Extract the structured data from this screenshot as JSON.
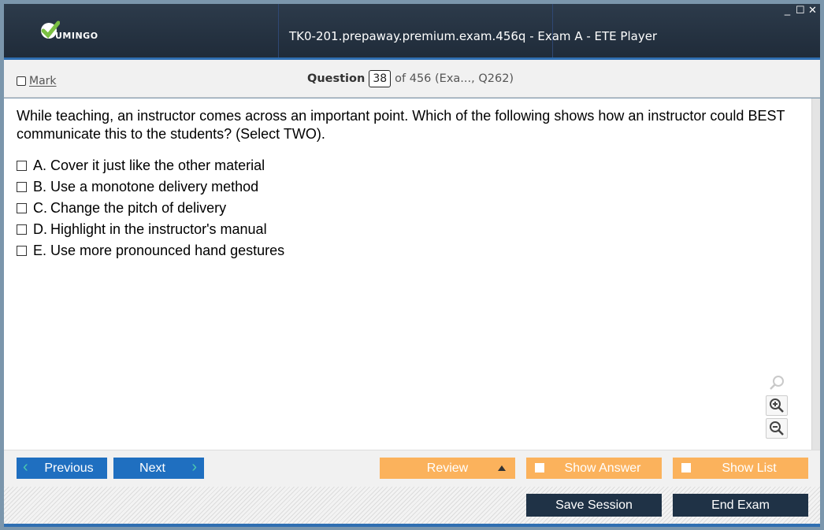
{
  "app": {
    "logo_text": "UMINGO",
    "title": "TK0-201.prepaway.premium.exam.456q - Exam A - ETE Player",
    "window_controls": {
      "minimize": "_",
      "maximize": "☐",
      "close": "✕"
    }
  },
  "header": {
    "mark_label": "Mark",
    "question_label": "Question",
    "question_number": "38",
    "question_of": "of 456 (Exa..., Q262)"
  },
  "question": {
    "text": "While teaching, an instructor comes across an important point. Which of the following shows how an instructor could BEST communicate this to the students? (Select TWO).",
    "answers": [
      {
        "letter": "A.",
        "text": "Cover it just like the other material"
      },
      {
        "letter": "B.",
        "text": "Use a monotone delivery method"
      },
      {
        "letter": "C.",
        "text": "Change the pitch of delivery"
      },
      {
        "letter": "D.",
        "text": "Highlight in the instructor's manual"
      },
      {
        "letter": "E.",
        "text": "Use more pronounced hand gestures"
      }
    ]
  },
  "zoom_tools": [
    "search-icon",
    "zoom-in-icon",
    "zoom-out-icon"
  ],
  "nav": {
    "previous": "Previous",
    "next": "Next",
    "review": "Review",
    "show_answer": "Show Answer",
    "show_list": "Show List"
  },
  "footer": {
    "save_session": "Save Session",
    "end_exam": "End Exam"
  },
  "colors": {
    "title_bg": "#253241",
    "accent_blue": "#1f6fc0",
    "orange": "#fbb25c",
    "dark_button": "#1f3246",
    "chevron": "#4cc8b0"
  }
}
